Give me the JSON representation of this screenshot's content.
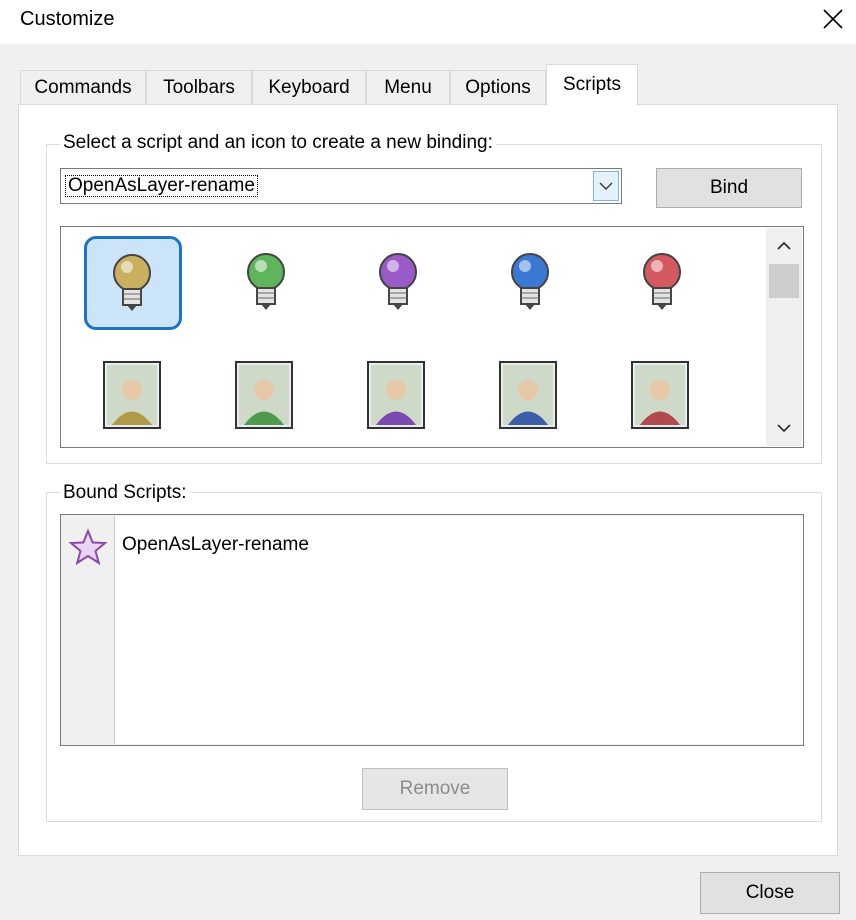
{
  "window": {
    "title": "Customize",
    "close_icon": "close-icon"
  },
  "tabs": [
    {
      "label": "Commands",
      "active": false
    },
    {
      "label": "Toolbars",
      "active": false
    },
    {
      "label": "Keyboard",
      "active": false
    },
    {
      "label": "Menu",
      "active": false
    },
    {
      "label": "Options",
      "active": false
    },
    {
      "label": "Scripts",
      "active": true
    }
  ],
  "scripts_group": {
    "legend": "Select a script and an icon to create a new binding:",
    "script_select": {
      "selected": "OpenAsLayer-rename"
    },
    "bind_label": "Bind",
    "icons": [
      {
        "name": "bulb-yellow-icon",
        "color": "#c8b060",
        "selected": true
      },
      {
        "name": "bulb-green-icon",
        "color": "#5fb55a",
        "selected": false
      },
      {
        "name": "bulb-purple-icon",
        "color": "#9a5ac8",
        "selected": false
      },
      {
        "name": "bulb-blue-icon",
        "color": "#3a78d4",
        "selected": false
      },
      {
        "name": "bulb-red-icon",
        "color": "#d45a60",
        "selected": false
      },
      {
        "name": "portrait-yellow-icon",
        "color": "#b09a4a",
        "selected": false
      },
      {
        "name": "portrait-green-icon",
        "color": "#4f9a4c",
        "selected": false
      },
      {
        "name": "portrait-purple-icon",
        "color": "#7a4ab0",
        "selected": false
      },
      {
        "name": "portrait-blue-icon",
        "color": "#3a5fa8",
        "selected": false
      },
      {
        "name": "portrait-red-icon",
        "color": "#b04a4f",
        "selected": false
      }
    ]
  },
  "bound_group": {
    "legend": "Bound Scripts:",
    "items": [
      {
        "label": "OpenAsLayer-rename",
        "icon": "star-icon"
      }
    ],
    "remove_label": "Remove"
  },
  "footer": {
    "close_label": "Close"
  }
}
